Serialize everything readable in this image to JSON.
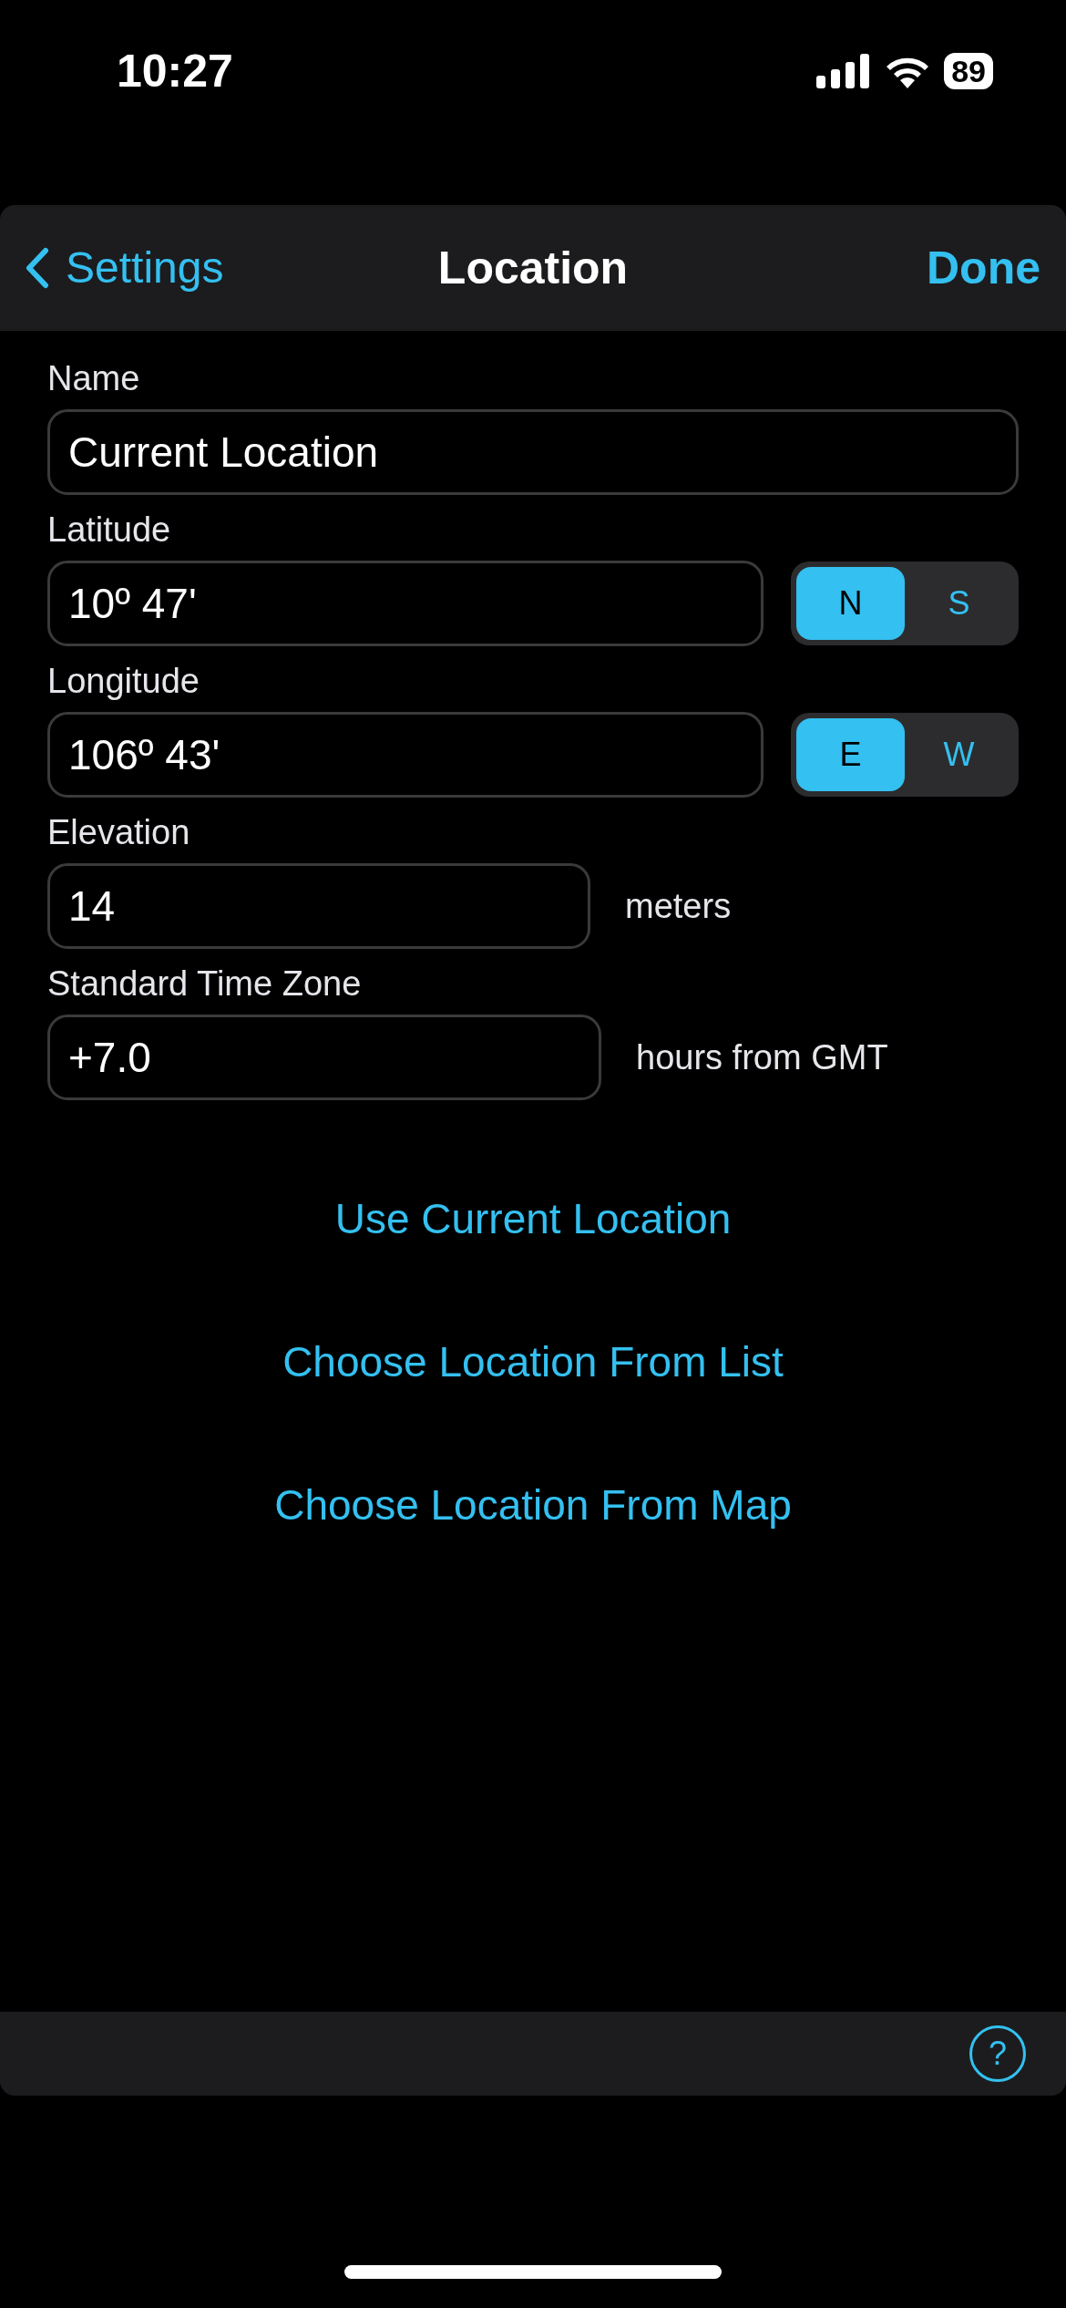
{
  "status_bar": {
    "time": "10:27",
    "battery": "89"
  },
  "nav_bar": {
    "back": "Settings",
    "title": "Location",
    "done": "Done"
  },
  "fields": [
    {
      "kind": "text",
      "label": "Name",
      "value": "Current Location"
    },
    {
      "kind": "segmented",
      "label": "Latitude",
      "value": "10º 47'",
      "options": [
        {
          "label": "N",
          "selected": true
        },
        {
          "label": "S",
          "selected": false
        }
      ]
    },
    {
      "kind": "segmented",
      "label": "Longitude",
      "value": "106º 43'",
      "options": [
        {
          "label": "E",
          "selected": true
        },
        {
          "label": "W",
          "selected": false
        }
      ]
    },
    {
      "kind": "unit",
      "label": "Elevation",
      "value": "14",
      "unit": "meters"
    },
    {
      "kind": "unit",
      "label": "Standard Time Zone",
      "value": "+7.0",
      "unit": "hours from GMT"
    }
  ],
  "links": [
    "Use Current Location",
    "Choose Location From List",
    "Choose Location From Map"
  ],
  "bottom_bar": {
    "help": "?"
  }
}
